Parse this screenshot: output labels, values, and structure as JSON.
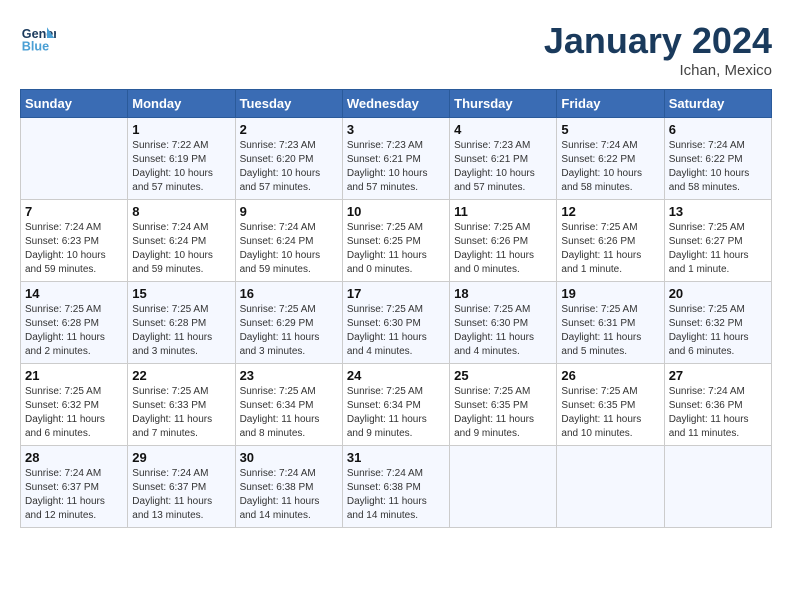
{
  "header": {
    "logo_line1": "General",
    "logo_line2": "Blue",
    "month_title": "January 2024",
    "location": "Ichan, Mexico"
  },
  "days_of_week": [
    "Sunday",
    "Monday",
    "Tuesday",
    "Wednesday",
    "Thursday",
    "Friday",
    "Saturday"
  ],
  "weeks": [
    [
      {
        "day": "",
        "sunrise": "",
        "sunset": "",
        "daylight": ""
      },
      {
        "day": "1",
        "sunrise": "7:22 AM",
        "sunset": "6:19 PM",
        "daylight": "10 hours and 57 minutes."
      },
      {
        "day": "2",
        "sunrise": "7:23 AM",
        "sunset": "6:20 PM",
        "daylight": "10 hours and 57 minutes."
      },
      {
        "day": "3",
        "sunrise": "7:23 AM",
        "sunset": "6:21 PM",
        "daylight": "10 hours and 57 minutes."
      },
      {
        "day": "4",
        "sunrise": "7:23 AM",
        "sunset": "6:21 PM",
        "daylight": "10 hours and 57 minutes."
      },
      {
        "day": "5",
        "sunrise": "7:24 AM",
        "sunset": "6:22 PM",
        "daylight": "10 hours and 58 minutes."
      },
      {
        "day": "6",
        "sunrise": "7:24 AM",
        "sunset": "6:22 PM",
        "daylight": "10 hours and 58 minutes."
      }
    ],
    [
      {
        "day": "7",
        "sunrise": "7:24 AM",
        "sunset": "6:23 PM",
        "daylight": "10 hours and 59 minutes."
      },
      {
        "day": "8",
        "sunrise": "7:24 AM",
        "sunset": "6:24 PM",
        "daylight": "10 hours and 59 minutes."
      },
      {
        "day": "9",
        "sunrise": "7:24 AM",
        "sunset": "6:24 PM",
        "daylight": "10 hours and 59 minutes."
      },
      {
        "day": "10",
        "sunrise": "7:25 AM",
        "sunset": "6:25 PM",
        "daylight": "11 hours and 0 minutes."
      },
      {
        "day": "11",
        "sunrise": "7:25 AM",
        "sunset": "6:26 PM",
        "daylight": "11 hours and 0 minutes."
      },
      {
        "day": "12",
        "sunrise": "7:25 AM",
        "sunset": "6:26 PM",
        "daylight": "11 hours and 1 minute."
      },
      {
        "day": "13",
        "sunrise": "7:25 AM",
        "sunset": "6:27 PM",
        "daylight": "11 hours and 1 minute."
      }
    ],
    [
      {
        "day": "14",
        "sunrise": "7:25 AM",
        "sunset": "6:28 PM",
        "daylight": "11 hours and 2 minutes."
      },
      {
        "day": "15",
        "sunrise": "7:25 AM",
        "sunset": "6:28 PM",
        "daylight": "11 hours and 3 minutes."
      },
      {
        "day": "16",
        "sunrise": "7:25 AM",
        "sunset": "6:29 PM",
        "daylight": "11 hours and 3 minutes."
      },
      {
        "day": "17",
        "sunrise": "7:25 AM",
        "sunset": "6:30 PM",
        "daylight": "11 hours and 4 minutes."
      },
      {
        "day": "18",
        "sunrise": "7:25 AM",
        "sunset": "6:30 PM",
        "daylight": "11 hours and 4 minutes."
      },
      {
        "day": "19",
        "sunrise": "7:25 AM",
        "sunset": "6:31 PM",
        "daylight": "11 hours and 5 minutes."
      },
      {
        "day": "20",
        "sunrise": "7:25 AM",
        "sunset": "6:32 PM",
        "daylight": "11 hours and 6 minutes."
      }
    ],
    [
      {
        "day": "21",
        "sunrise": "7:25 AM",
        "sunset": "6:32 PM",
        "daylight": "11 hours and 6 minutes."
      },
      {
        "day": "22",
        "sunrise": "7:25 AM",
        "sunset": "6:33 PM",
        "daylight": "11 hours and 7 minutes."
      },
      {
        "day": "23",
        "sunrise": "7:25 AM",
        "sunset": "6:34 PM",
        "daylight": "11 hours and 8 minutes."
      },
      {
        "day": "24",
        "sunrise": "7:25 AM",
        "sunset": "6:34 PM",
        "daylight": "11 hours and 9 minutes."
      },
      {
        "day": "25",
        "sunrise": "7:25 AM",
        "sunset": "6:35 PM",
        "daylight": "11 hours and 9 minutes."
      },
      {
        "day": "26",
        "sunrise": "7:25 AM",
        "sunset": "6:35 PM",
        "daylight": "11 hours and 10 minutes."
      },
      {
        "day": "27",
        "sunrise": "7:24 AM",
        "sunset": "6:36 PM",
        "daylight": "11 hours and 11 minutes."
      }
    ],
    [
      {
        "day": "28",
        "sunrise": "7:24 AM",
        "sunset": "6:37 PM",
        "daylight": "11 hours and 12 minutes."
      },
      {
        "day": "29",
        "sunrise": "7:24 AM",
        "sunset": "6:37 PM",
        "daylight": "11 hours and 13 minutes."
      },
      {
        "day": "30",
        "sunrise": "7:24 AM",
        "sunset": "6:38 PM",
        "daylight": "11 hours and 14 minutes."
      },
      {
        "day": "31",
        "sunrise": "7:24 AM",
        "sunset": "6:38 PM",
        "daylight": "11 hours and 14 minutes."
      },
      {
        "day": "",
        "sunrise": "",
        "sunset": "",
        "daylight": ""
      },
      {
        "day": "",
        "sunrise": "",
        "sunset": "",
        "daylight": ""
      },
      {
        "day": "",
        "sunrise": "",
        "sunset": "",
        "daylight": ""
      }
    ]
  ]
}
